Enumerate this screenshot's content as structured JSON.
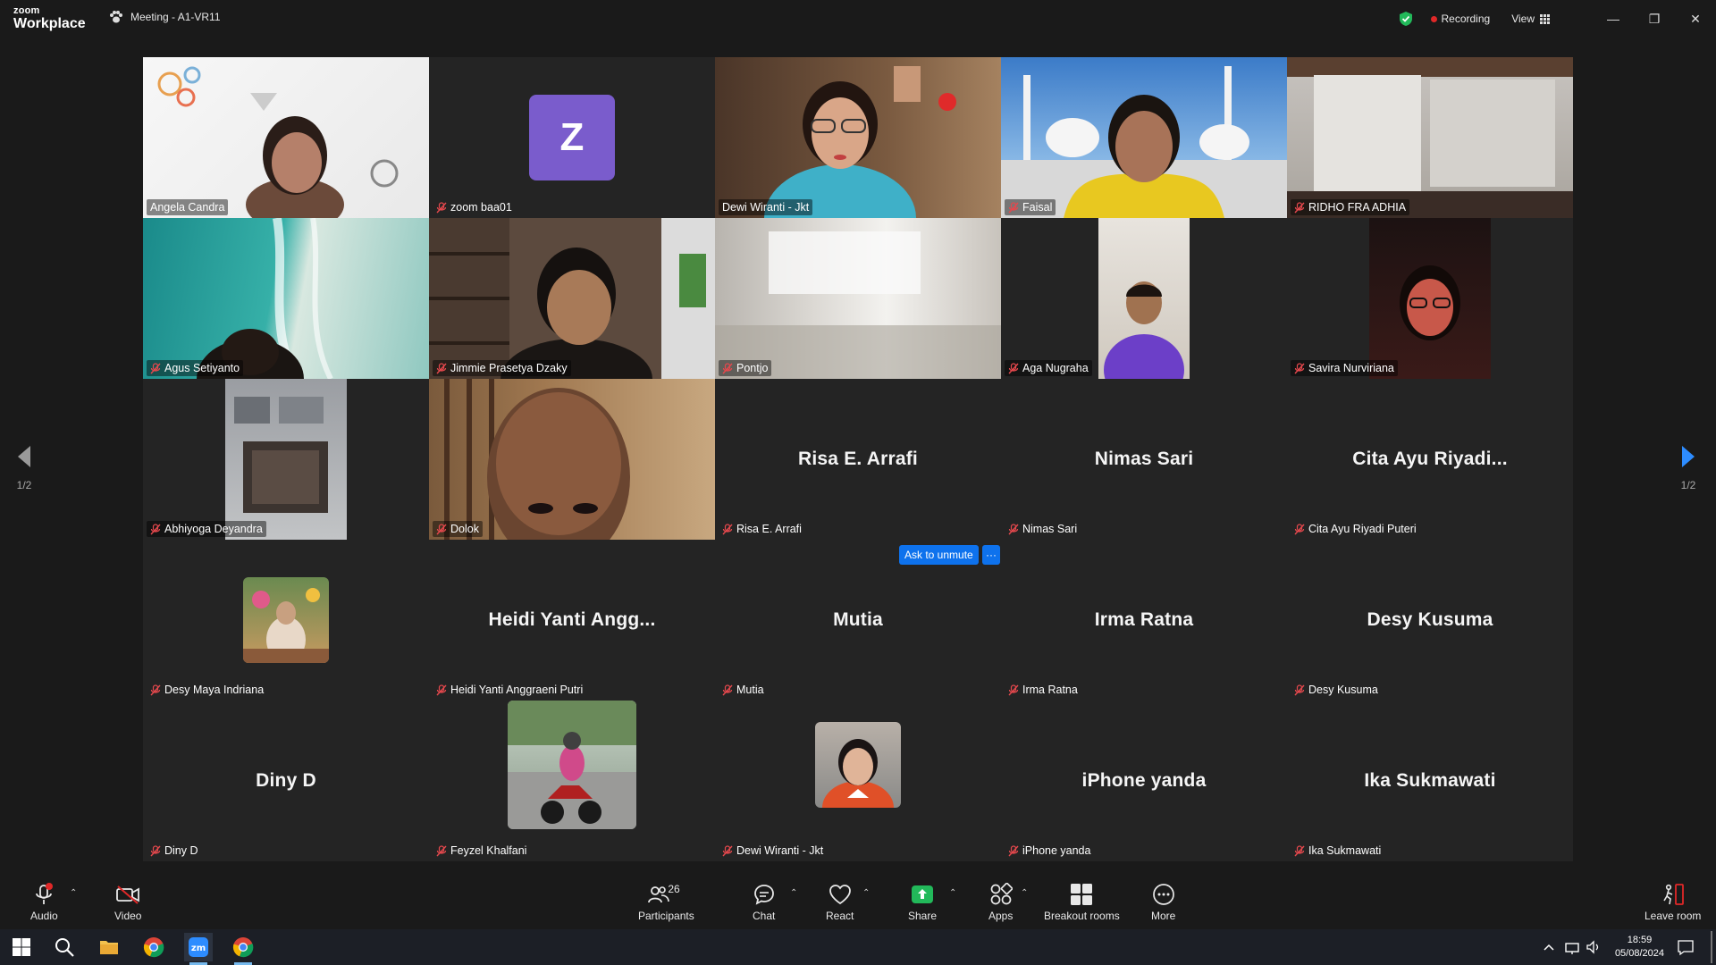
{
  "app": {
    "logo_line1": "zoom",
    "logo_line2": "Workplace",
    "meeting_title": "Meeting - A1-VR11"
  },
  "header": {
    "recording": "Recording",
    "view": "View",
    "win_min": "—",
    "win_max": "❐",
    "win_close": "✕"
  },
  "tiles": [
    {
      "name": "Angela Candra",
      "big": "",
      "kind": "video-light",
      "muted": false
    },
    {
      "name": "zoom baa01",
      "big": "",
      "kind": "avatar",
      "avatar": "Z",
      "muted": true
    },
    {
      "name": "Dewi Wiranti - Jkt",
      "big": "",
      "kind": "video-active",
      "muted": false
    },
    {
      "name": "Faisal",
      "big": "",
      "kind": "video-mosque",
      "muted": true
    },
    {
      "name": "RIDHO FRA ADHIA",
      "big": "",
      "kind": "video-room",
      "muted": true
    },
    {
      "name": "Agus Setiyanto",
      "big": "",
      "kind": "video-ocean",
      "muted": true
    },
    {
      "name": "Jimmie Prasetya Dzaky",
      "big": "",
      "kind": "video-shelf",
      "muted": true
    },
    {
      "name": "Pontjo",
      "big": "",
      "kind": "video-blur",
      "muted": true
    },
    {
      "name": "Aga Nugraha",
      "big": "",
      "kind": "video-portrait",
      "muted": true
    },
    {
      "name": "Savira Nurviriana",
      "big": "",
      "kind": "video-dark",
      "muted": true
    },
    {
      "name": "Abhiyoga Deyandra",
      "big": "",
      "kind": "video-portrait2",
      "muted": true
    },
    {
      "name": "Dolok",
      "big": "",
      "kind": "video-bald",
      "muted": true
    },
    {
      "name": "Risa E. Arrafi",
      "big": "Risa E. Arrafi",
      "kind": "name",
      "muted": true
    },
    {
      "name": "Nimas Sari",
      "big": "Nimas Sari",
      "kind": "name",
      "muted": true
    },
    {
      "name": "Cita Ayu Riyadi Puteri",
      "big": "Cita Ayu Riyadi...",
      "kind": "name",
      "muted": true
    },
    {
      "name": "Desy Maya Indriana",
      "big": "",
      "kind": "photo-small",
      "muted": true
    },
    {
      "name": "Heidi Yanti Anggraeni Putri",
      "big": "Heidi Yanti Angg...",
      "kind": "name",
      "muted": true
    },
    {
      "name": "Mutia",
      "big": "Mutia",
      "kind": "name",
      "muted": true
    },
    {
      "name": "Irma Ratna",
      "big": "Irma Ratna",
      "kind": "name",
      "muted": true
    },
    {
      "name": "Desy Kusuma",
      "big": "Desy Kusuma",
      "kind": "name",
      "muted": true
    },
    {
      "name": "Diny D",
      "big": "Diny D",
      "kind": "name",
      "muted": true
    },
    {
      "name": "Feyzel Khalfani",
      "big": "",
      "kind": "photo-moto",
      "muted": true
    },
    {
      "name": "Dewi Wiranti - Jkt",
      "big": "",
      "kind": "photo-small2",
      "muted": true
    },
    {
      "name": "iPhone yanda",
      "big": "iPhone yanda",
      "kind": "name",
      "muted": true
    },
    {
      "name": "Ika Sukmawati",
      "big": "Ika Sukmawati",
      "kind": "name",
      "muted": true
    }
  ],
  "overlay": {
    "ask_unmute": "Ask to unmute",
    "more": "···"
  },
  "pager": {
    "left": "1/2",
    "right": "1/2"
  },
  "toolbar": {
    "audio": "Audio",
    "video": "Video",
    "participants": "Participants",
    "participants_count": "26",
    "chat": "Chat",
    "react": "React",
    "share": "Share",
    "apps": "Apps",
    "breakout": "Breakout rooms",
    "more": "More",
    "leave": "Leave room"
  },
  "taskbar": {
    "time": "18:59",
    "date": "05/08/2024"
  }
}
